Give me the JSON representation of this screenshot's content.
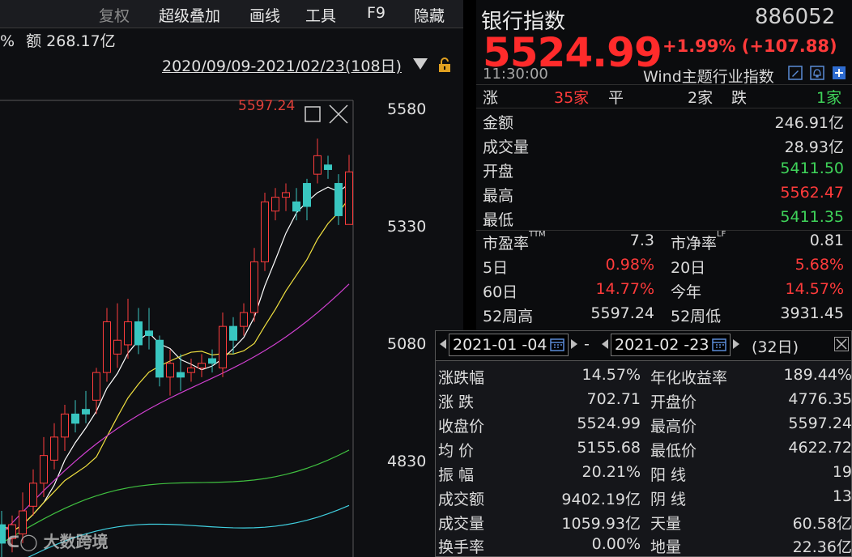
{
  "menu": {
    "items": [
      "复权",
      "超级叠加",
      "画线",
      "工具",
      "F9",
      "隐藏"
    ]
  },
  "left": {
    "pct_sym": "%",
    "amount_label": "额",
    "amount_value": "268.17亿",
    "date_range": "2020/09/09-2021/02/23(108日)",
    "high_label": "5597.24",
    "yticks": [
      "5580",
      "5330",
      "5080",
      "4830"
    ],
    "watermark": "大数跨境"
  },
  "quote": {
    "name": "银行指数",
    "code": "886052",
    "price": "5524.99",
    "change": "+1.99% (+107.88)",
    "time": "11:30:00",
    "category": "Wind主题行业指数",
    "breadth": {
      "up_label": "涨",
      "up_value": "35家",
      "flat_label": "平",
      "flat_value": "2家",
      "down_label": "跌",
      "down_value": "1家"
    },
    "stats": [
      {
        "label": "金额",
        "value": "246.91亿"
      },
      {
        "label": "成交量",
        "value": "28.93亿"
      },
      {
        "label": "开盘",
        "value": "5411.50"
      },
      {
        "label": "最高",
        "value": "5562.47"
      },
      {
        "label": "最低",
        "value": "5411.35"
      }
    ],
    "grid": [
      {
        "l1": "市盈率",
        "t1": "TTM",
        "v1": "7.3",
        "l2": "市净率",
        "t2": "LF",
        "v2": "0.81"
      },
      {
        "l1": "5日",
        "t1": "",
        "v1": "0.98%",
        "l2": "20日",
        "t2": "",
        "v2": "5.68%"
      },
      {
        "l1": "60日",
        "t1": "",
        "v1": "14.77%",
        "l2": "今年",
        "t2": "",
        "v2": "14.57%"
      },
      {
        "l1": "52周高",
        "t1": "",
        "v1": "5597.24",
        "l2": "52周低",
        "t2": "",
        "v2": "3931.45"
      }
    ]
  },
  "popup": {
    "start_date": "2021-01 -04",
    "dash": "-",
    "end_date": "2021-02 -23",
    "days": "(32日)",
    "rows": [
      {
        "l1": "涨跌幅",
        "v1": "14.57%",
        "l2": "年化收益率",
        "v2": "189.44%"
      },
      {
        "l1": "涨  跌",
        "v1": "702.71",
        "l2": "开盘价",
        "v2": "4776.35"
      },
      {
        "l1": "收盘价",
        "v1": "5524.99",
        "l2": "最高价",
        "v2": "5597.24"
      },
      {
        "l1": "均  价",
        "v1": "5155.68",
        "l2": "最低价",
        "v2": "4622.72"
      },
      {
        "l1": "振  幅",
        "v1": "20.21%",
        "l2": "阳  线",
        "v2": "19"
      },
      {
        "l1": "成交额",
        "v1": "9402.19亿",
        "l2": "阴  线",
        "v2": "13"
      },
      {
        "l1": "成交量",
        "v1": "1059.93亿",
        "l2": "天量",
        "v2": "60.58亿"
      },
      {
        "l1": "换手率",
        "v1": "0.00%",
        "l2": "地量",
        "v2": "22.36亿"
      }
    ]
  },
  "chart_data": {
    "type": "candlestick",
    "ylim": [
      4690,
      5680
    ],
    "candles": [
      {
        "o": 4720,
        "c": 4760,
        "h": 4790,
        "l": 4690,
        "up": false
      },
      {
        "o": 4760,
        "c": 4730,
        "h": 4780,
        "l": 4700,
        "up": true
      },
      {
        "o": 4740,
        "c": 4790,
        "h": 4830,
        "l": 4720,
        "up": true
      },
      {
        "o": 4800,
        "c": 4850,
        "h": 4880,
        "l": 4780,
        "up": true
      },
      {
        "o": 4850,
        "c": 4910,
        "h": 4950,
        "l": 4820,
        "up": true
      },
      {
        "o": 4900,
        "c": 4950,
        "h": 4980,
        "l": 4880,
        "up": true
      },
      {
        "o": 4950,
        "c": 5000,
        "h": 5020,
        "l": 4920,
        "up": true
      },
      {
        "o": 5000,
        "c": 4980,
        "h": 5030,
        "l": 4960,
        "up": false
      },
      {
        "o": 5000,
        "c": 5010,
        "h": 5050,
        "l": 4980,
        "up": false
      },
      {
        "o": 5030,
        "c": 5090,
        "h": 5100,
        "l": 5000,
        "up": true
      },
      {
        "o": 5090,
        "c": 5200,
        "h": 5230,
        "l": 5070,
        "up": true
      },
      {
        "o": 5130,
        "c": 5160,
        "h": 5240,
        "l": 5100,
        "up": true
      },
      {
        "o": 5150,
        "c": 5200,
        "h": 5250,
        "l": 5120,
        "up": true
      },
      {
        "o": 5200,
        "c": 5150,
        "h": 5230,
        "l": 5130,
        "up": false
      },
      {
        "o": 5180,
        "c": 5170,
        "h": 5230,
        "l": 5140,
        "up": false
      },
      {
        "o": 5160,
        "c": 5080,
        "h": 5170,
        "l": 5060,
        "up": false
      },
      {
        "o": 5080,
        "c": 5110,
        "h": 5140,
        "l": 5040,
        "up": true
      },
      {
        "o": 5090,
        "c": 5080,
        "h": 5130,
        "l": 5050,
        "up": false
      },
      {
        "o": 5090,
        "c": 5100,
        "h": 5120,
        "l": 5070,
        "up": true
      },
      {
        "o": 5100,
        "c": 5110,
        "h": 5130,
        "l": 5080,
        "up": true
      },
      {
        "o": 5110,
        "c": 5120,
        "h": 5140,
        "l": 5090,
        "up": false
      },
      {
        "o": 5100,
        "c": 5190,
        "h": 5220,
        "l": 5080,
        "up": true
      },
      {
        "o": 5160,
        "c": 5190,
        "h": 5210,
        "l": 5130,
        "up": false
      },
      {
        "o": 5190,
        "c": 5220,
        "h": 5240,
        "l": 5170,
        "up": true
      },
      {
        "o": 5220,
        "c": 5330,
        "h": 5360,
        "l": 5200,
        "up": true
      },
      {
        "o": 5330,
        "c": 5460,
        "h": 5480,
        "l": 5310,
        "up": true
      },
      {
        "o": 5440,
        "c": 5470,
        "h": 5490,
        "l": 5420,
        "up": true
      },
      {
        "o": 5470,
        "c": 5480,
        "h": 5500,
        "l": 5440,
        "up": true
      },
      {
        "o": 5460,
        "c": 5440,
        "h": 5490,
        "l": 5420,
        "up": false
      },
      {
        "o": 5500,
        "c": 5450,
        "h": 5510,
        "l": 5420,
        "up": false
      },
      {
        "o": 5520,
        "c": 5560,
        "h": 5597,
        "l": 5500,
        "up": true
      },
      {
        "o": 5540,
        "c": 5530,
        "h": 5560,
        "l": 5510,
        "up": false
      },
      {
        "o": 5500,
        "c": 5430,
        "h": 5520,
        "l": 5410,
        "up": false
      },
      {
        "o": 5411,
        "c": 5525,
        "h": 5562,
        "l": 5411,
        "up": true
      }
    ]
  }
}
